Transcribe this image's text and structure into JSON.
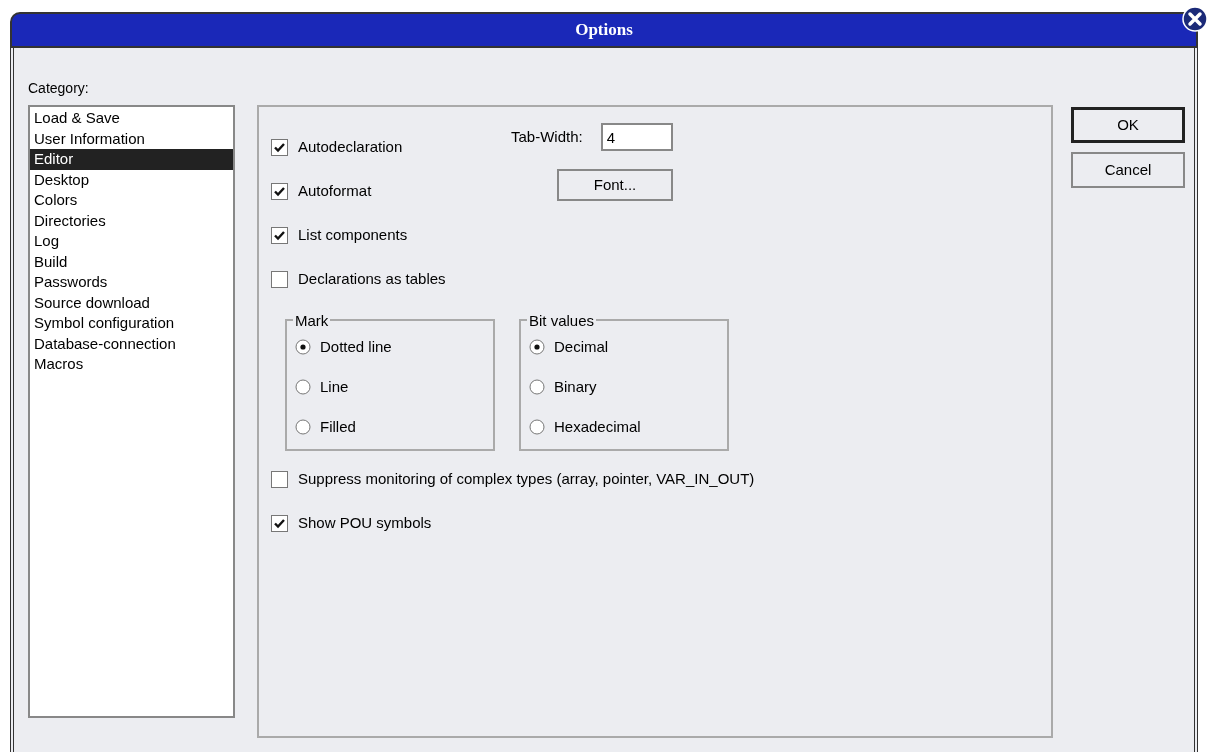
{
  "window": {
    "title": "Options"
  },
  "category_label": "Category:",
  "categories": [
    {
      "label": "Load & Save",
      "selected": false
    },
    {
      "label": "User Information",
      "selected": false
    },
    {
      "label": "Editor",
      "selected": true
    },
    {
      "label": "Desktop",
      "selected": false
    },
    {
      "label": "Colors",
      "selected": false
    },
    {
      "label": "Directories",
      "selected": false
    },
    {
      "label": "Log",
      "selected": false
    },
    {
      "label": "Build",
      "selected": false
    },
    {
      "label": "Passwords",
      "selected": false
    },
    {
      "label": "Source download",
      "selected": false
    },
    {
      "label": "Symbol configuration",
      "selected": false
    },
    {
      "label": "Database-connection",
      "selected": false
    },
    {
      "label": "Macros",
      "selected": false
    }
  ],
  "options_top": [
    {
      "label": "Autodeclaration",
      "checked": true
    },
    {
      "label": "Autoformat",
      "checked": true
    },
    {
      "label": "List components",
      "checked": true
    },
    {
      "label": "Declarations as tables",
      "checked": false
    }
  ],
  "tab_width": {
    "label": "Tab-Width:",
    "value": "4"
  },
  "font_button": "Font...",
  "groups": [
    {
      "title": "Mark",
      "options": [
        {
          "label": "Dotted line",
          "selected": true
        },
        {
          "label": "Line",
          "selected": false
        },
        {
          "label": "Filled",
          "selected": false
        }
      ]
    },
    {
      "title": "Bit values",
      "options": [
        {
          "label": "Decimal",
          "selected": true
        },
        {
          "label": "Binary",
          "selected": false
        },
        {
          "label": "Hexadecimal",
          "selected": false
        }
      ]
    }
  ],
  "options_bottom": [
    {
      "label": "Suppress monitoring of complex types (array, pointer, VAR_IN_OUT)",
      "checked": false
    },
    {
      "label": "Show POU symbols",
      "checked": true
    }
  ],
  "buttons": [
    {
      "label": "OK",
      "default": true
    },
    {
      "label": "Cancel",
      "default": false
    }
  ]
}
